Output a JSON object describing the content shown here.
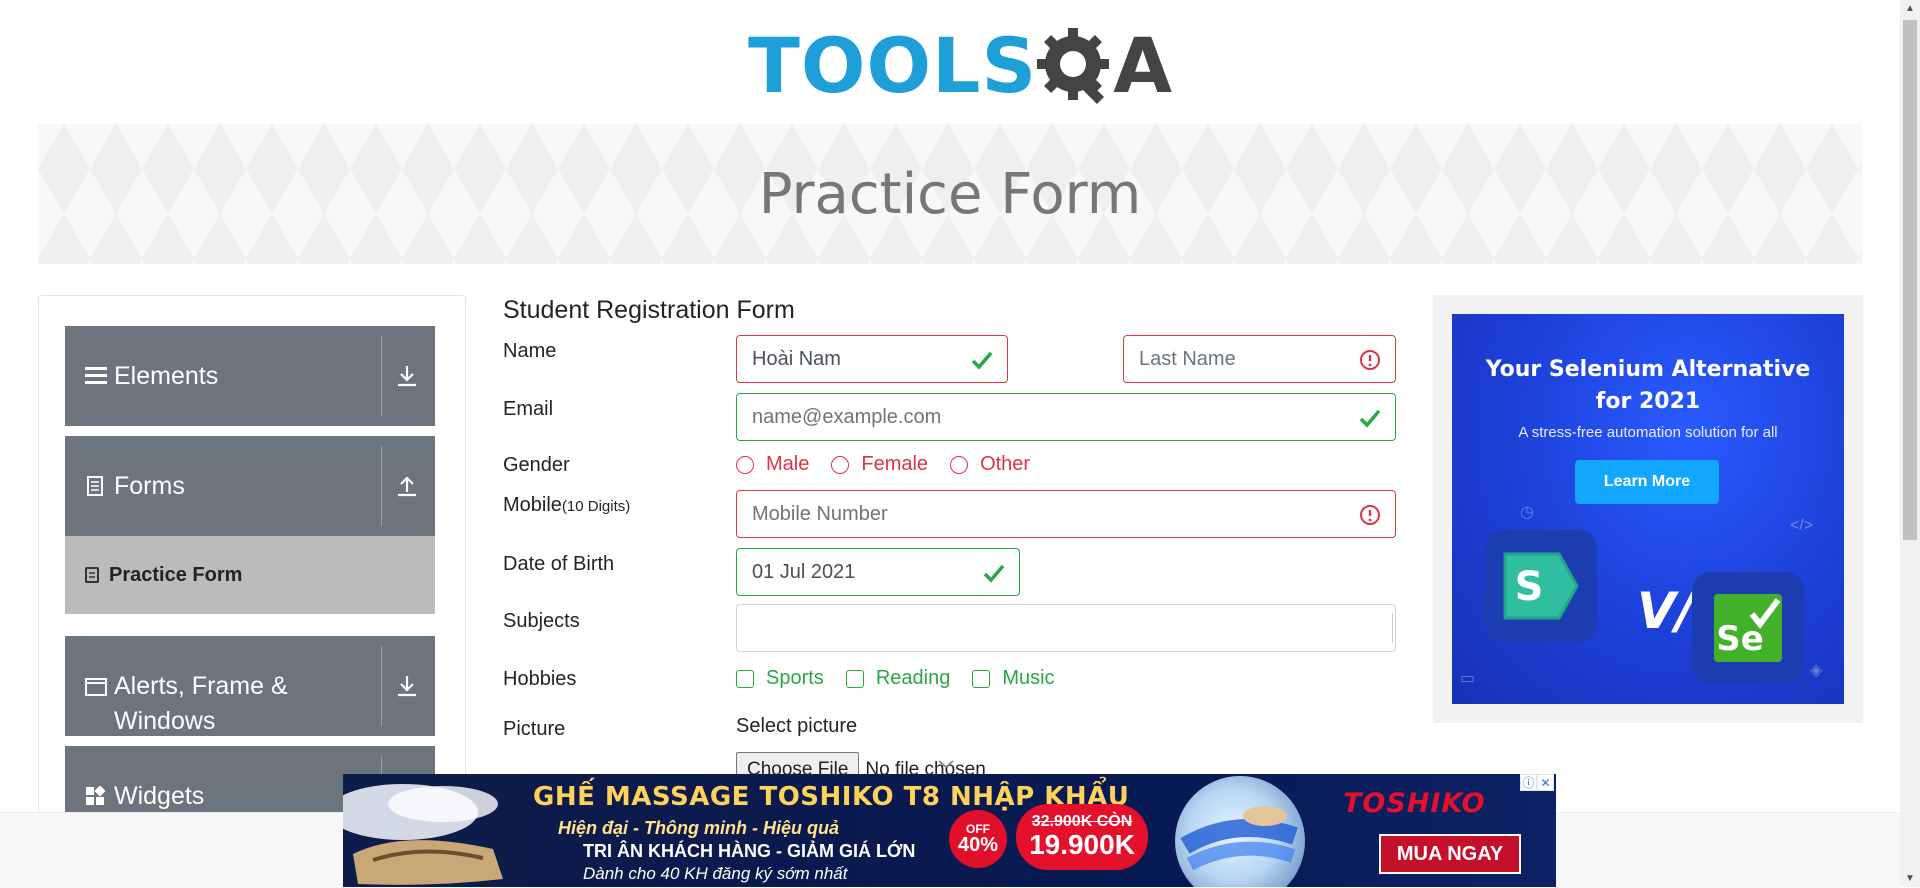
{
  "logo": {
    "tools": "TOOLS",
    "qa": "A"
  },
  "banner": {
    "title": "Practice Form"
  },
  "sidebar": {
    "groups": [
      {
        "label": "Elements",
        "icon": "menu-icon",
        "toggle": "download-icon"
      },
      {
        "label": "Forms",
        "icon": "document-icon",
        "toggle": "upload-icon"
      },
      {
        "label": "Alerts, Frame &",
        "label_line2": "Windows",
        "icon": "window-icon",
        "toggle": "download-icon"
      },
      {
        "label": "Widgets",
        "icon": "widgets-icon"
      }
    ],
    "active_item": {
      "label": "Practice Form",
      "icon": "form-icon"
    }
  },
  "form": {
    "title": "Student Registration Form",
    "name": {
      "label": "Name",
      "first_value": "Hoài Nam",
      "last_placeholder": "Last Name"
    },
    "email": {
      "label": "Email",
      "placeholder": "name@example.com"
    },
    "gender": {
      "label": "Gender",
      "options": [
        "Male",
        "Female",
        "Other"
      ]
    },
    "mobile": {
      "label": "Mobile",
      "hint": "(10 Digits)",
      "placeholder": "Mobile Number"
    },
    "dob": {
      "label": "Date of Birth",
      "value": "01 Jul 2021"
    },
    "subjects": {
      "label": "Subjects"
    },
    "hobbies": {
      "label": "Hobbies",
      "options": [
        "Sports",
        "Reading",
        "Music"
      ]
    },
    "picture": {
      "label": "Picture",
      "select_label": "Select picture",
      "button": "Choose File",
      "status": "No file chosen"
    }
  },
  "right_ad": {
    "headline_line1": "Your Selenium Alternative",
    "headline_line2": "for 2021",
    "subtitle": "A stress-free automation solution for all",
    "button": "Learn More",
    "vs": "V/S"
  },
  "bottom_ad": {
    "headline": "GHẾ MASSAGE TOSHIKO T8 NHẬP KHẨU",
    "line2": "Hiện đại - Thông minh - Hiệu quả",
    "line3": "TRI ÂN KHÁCH HÀNG - GIẢM GIÁ LỚN",
    "line4": "Dành cho 40 KH đăng ký sớm nhất",
    "off_label": "OFF",
    "off_value": "40%",
    "old_price": "32.900K CÒN",
    "new_price": "19.900K",
    "brand": "TOSHIKO",
    "cta": "MUA NGAY"
  },
  "colors": {
    "brand_blue": "#1e9fd8",
    "menu_gray": "#6c757d",
    "valid_green": "#28a745",
    "invalid_red": "#dc3545"
  }
}
